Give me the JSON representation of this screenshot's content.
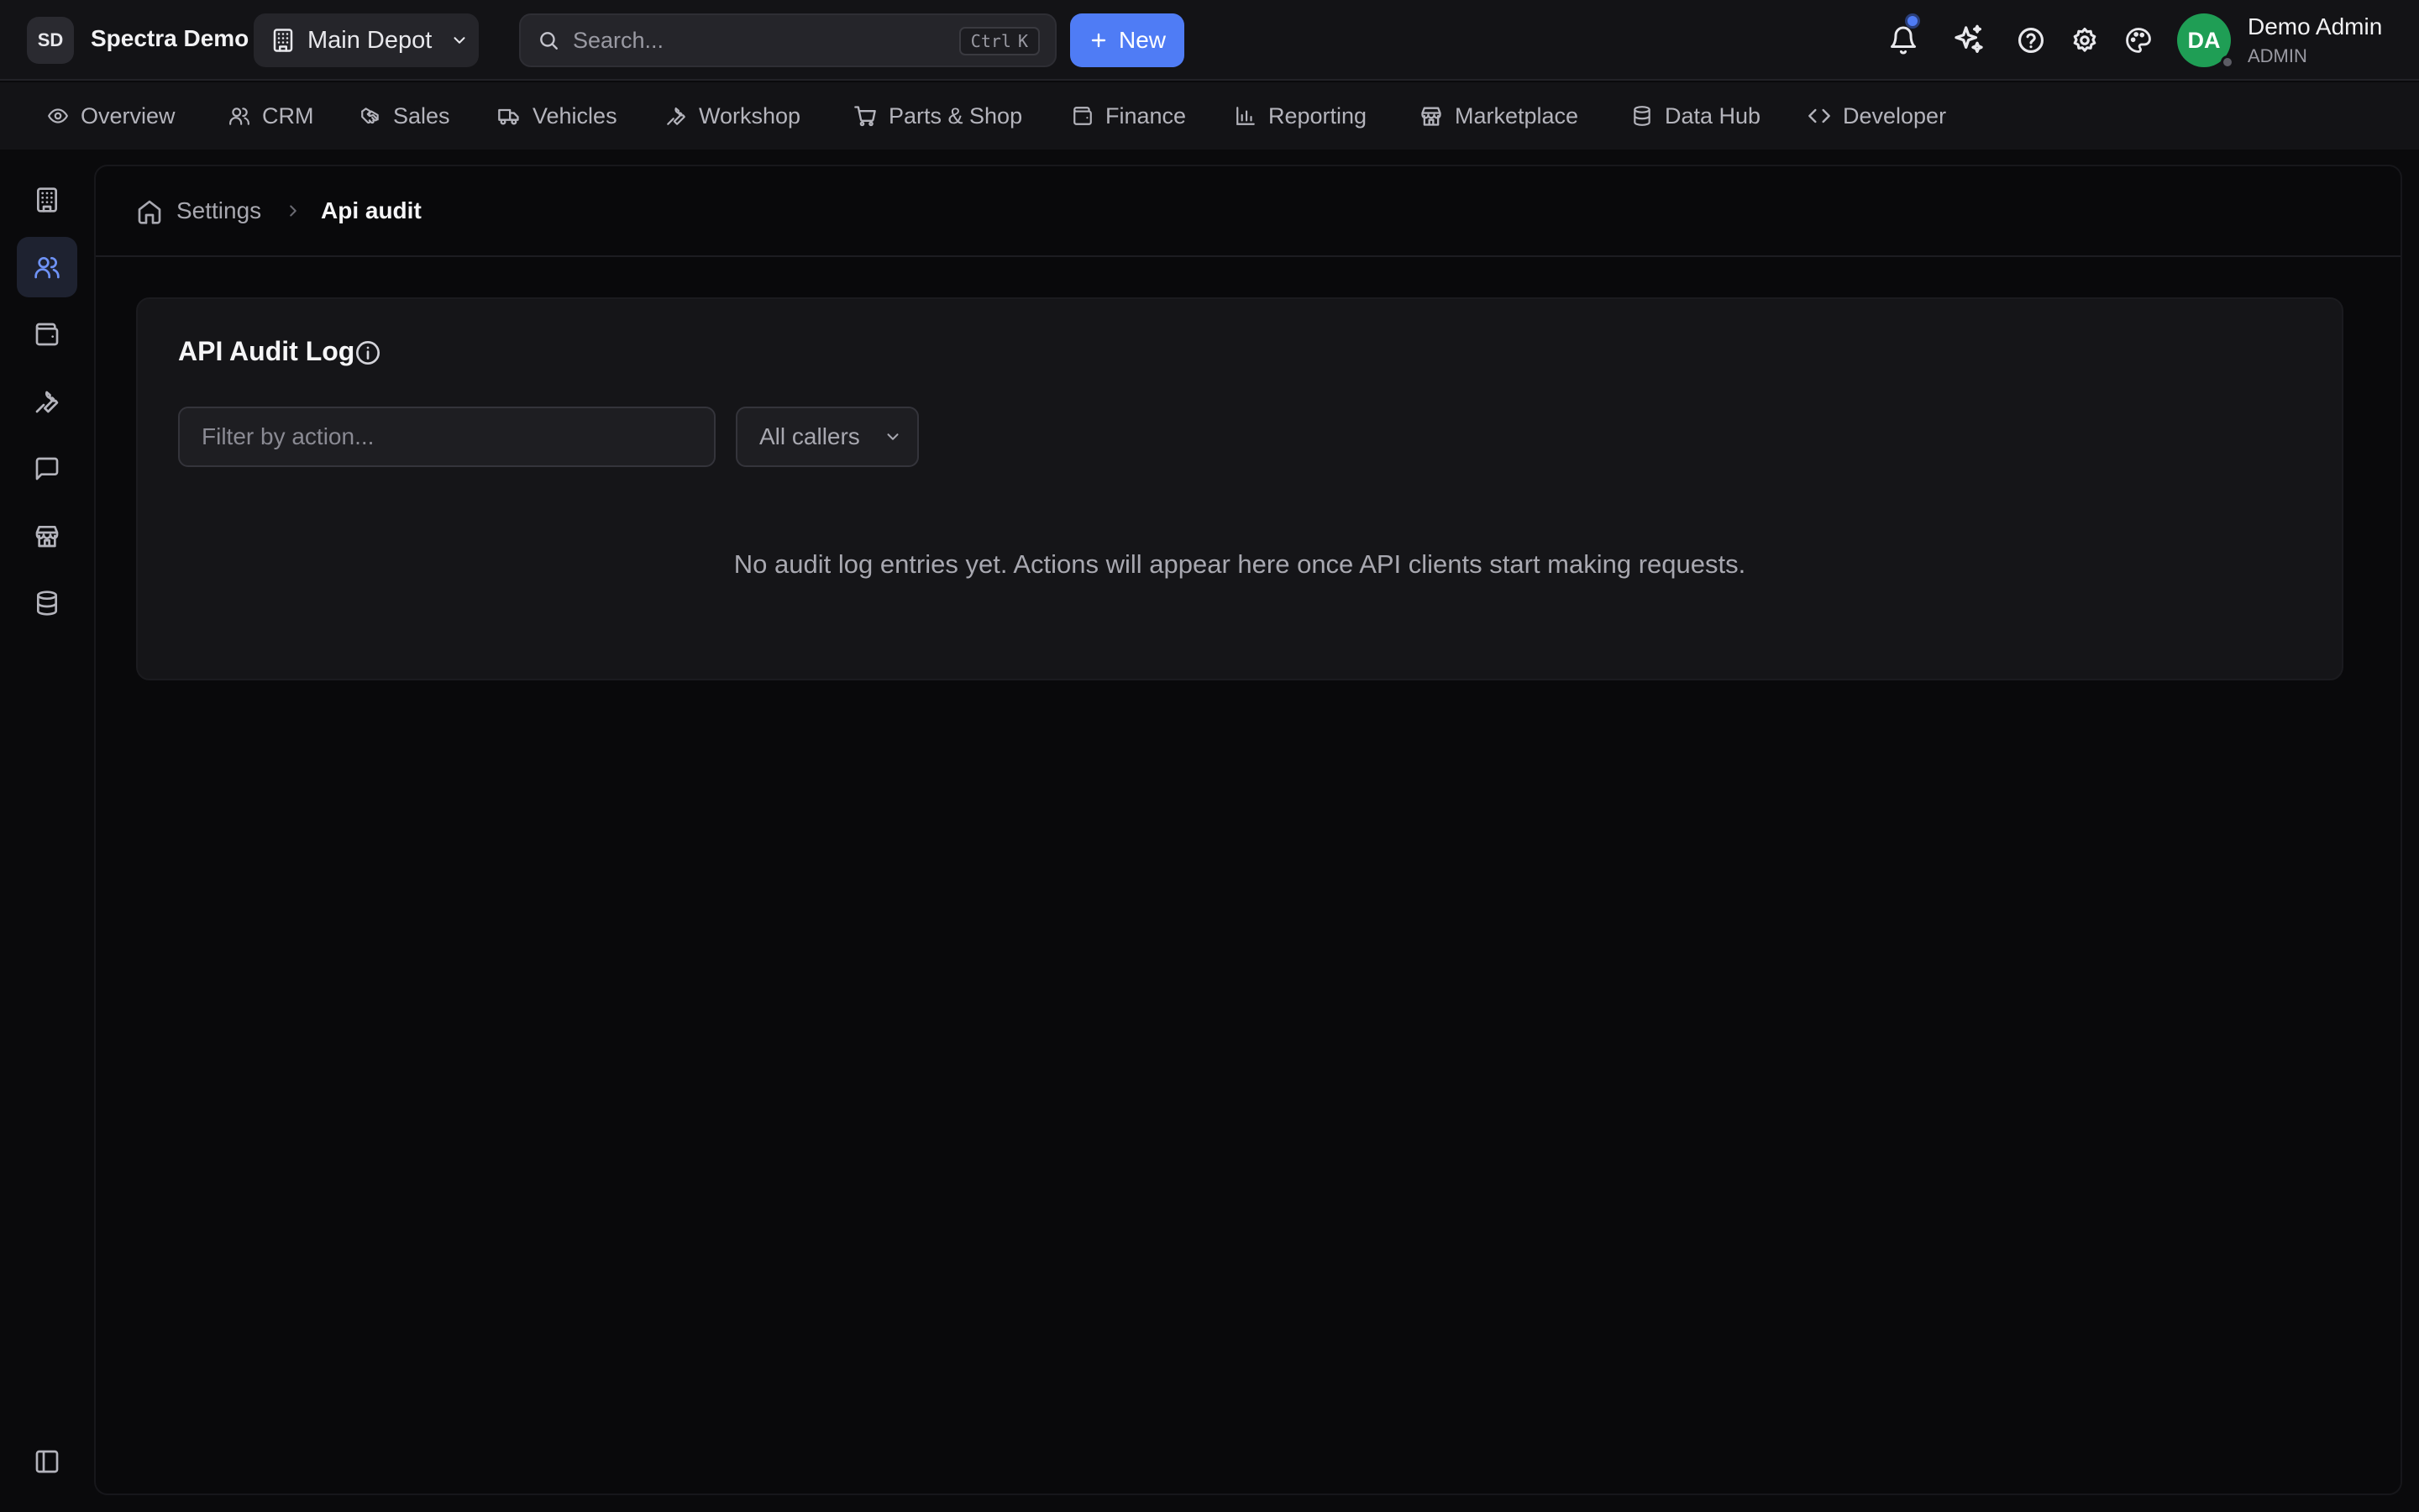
{
  "workspace": {
    "initials": "SD",
    "name": "Spectra Demo"
  },
  "depot": {
    "name": "Main Depot"
  },
  "search": {
    "placeholder": "Search...",
    "shortcut_mod": "Ctrl",
    "shortcut_key": "K"
  },
  "new_button": {
    "label": "New"
  },
  "user": {
    "initials": "DA",
    "name": "Demo Admin",
    "role": "ADMIN"
  },
  "modules": [
    {
      "label": "Overview",
      "icon": "eye-icon"
    },
    {
      "label": "CRM",
      "icon": "users-icon"
    },
    {
      "label": "Sales",
      "icon": "handshake-icon"
    },
    {
      "label": "Vehicles",
      "icon": "truck-icon"
    },
    {
      "label": "Workshop",
      "icon": "wrench-icon"
    },
    {
      "label": "Parts & Shop",
      "icon": "cart-icon"
    },
    {
      "label": "Finance",
      "icon": "wallet-icon"
    },
    {
      "label": "Reporting",
      "icon": "bar-chart-icon"
    },
    {
      "label": "Marketplace",
      "icon": "store-icon"
    },
    {
      "label": "Data Hub",
      "icon": "database-icon"
    },
    {
      "label": "Developer",
      "icon": "code-icon"
    }
  ],
  "breadcrumb": {
    "parent": "Settings",
    "current": "Api audit"
  },
  "audit": {
    "title": "API Audit Log",
    "filter_placeholder": "Filter by action...",
    "caller_select": "All callers",
    "empty_message": "No audit log entries yet. Actions will appear here once API clients start making requests."
  },
  "colors": {
    "accent": "#4f7cf5",
    "avatar": "#1f9e55",
    "background": "#0a0a0c"
  }
}
